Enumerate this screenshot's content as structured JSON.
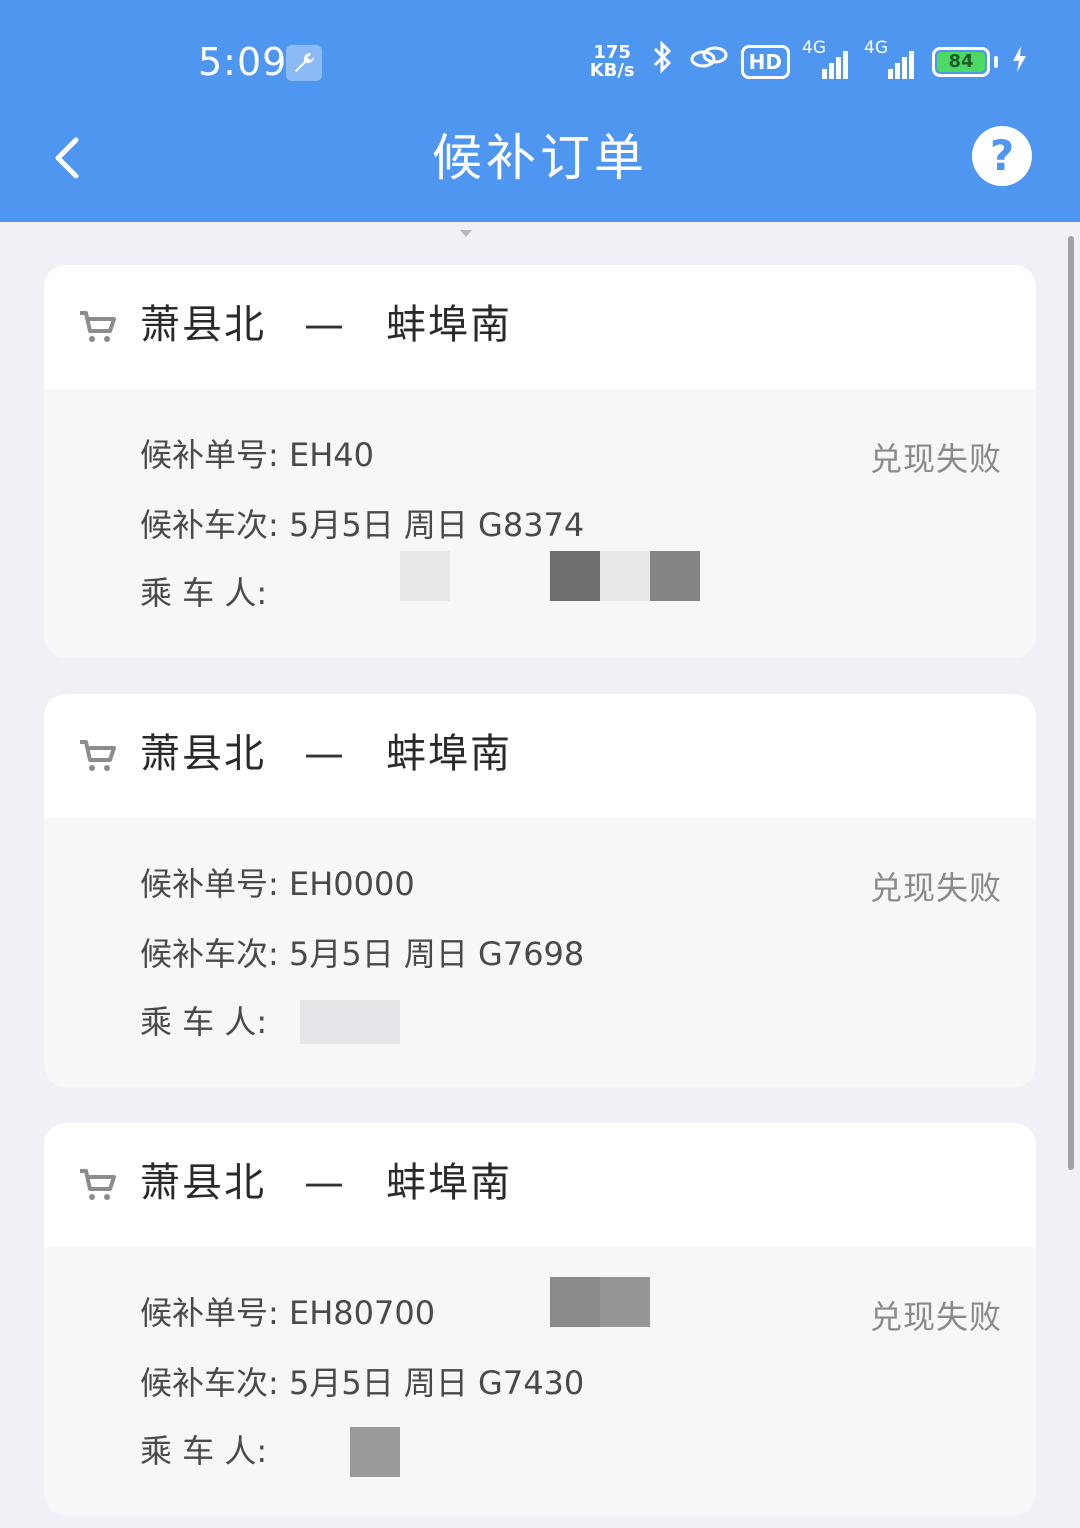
{
  "status_bar": {
    "time": "5:09",
    "net_speed_value": "175",
    "net_speed_unit": "KB/s",
    "hd_label": "HD",
    "network_1": "4G",
    "network_2": "4G",
    "battery_level": "84"
  },
  "nav": {
    "title": "候补订单",
    "help_label": "?"
  },
  "orders": [
    {
      "from": "萧县北",
      "dash": "—",
      "to": "蚌埠南",
      "order_no_label": "候补单号:",
      "order_no": "EH40",
      "train_label": "候补车次:",
      "train_info": "5月5日 周日 G8374",
      "passenger_label": "乘  车  人:",
      "status": "兑现失败"
    },
    {
      "from": "萧县北",
      "dash": "—",
      "to": "蚌埠南",
      "order_no_label": "候补单号:",
      "order_no": "EH0000",
      "train_label": "候补车次:",
      "train_info": "5月5日 周日 G7698",
      "passenger_label": "乘  车  人:",
      "status": "兑现失败"
    },
    {
      "from": "萧县北",
      "dash": "—",
      "to": "蚌埠南",
      "order_no_label": "候补单号:",
      "order_no": "EH80700",
      "train_label": "候补车次:",
      "train_info": "5月5日 周日 G7430",
      "passenger_label": "乘  车  人:",
      "status": "兑现失败"
    }
  ],
  "colors": {
    "header": "#4f96f0",
    "background": "#f0f0f6",
    "status_text": "#8a8a8a"
  }
}
